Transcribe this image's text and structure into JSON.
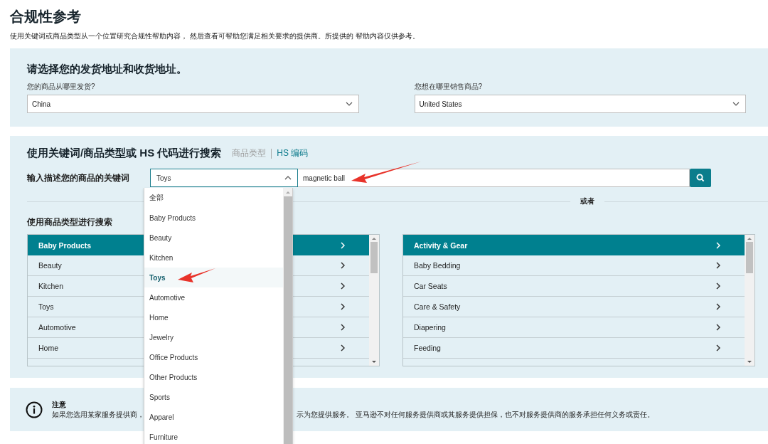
{
  "page": {
    "title": "合规性参考",
    "description": "使用关键词或商品类型从一个位置研究合规性帮助内容， 然后查看可帮助您满足相关要求的提供商。所提供的 帮助内容仅供参考。"
  },
  "address": {
    "title": "请选择您的发货地址和收货地址。",
    "fields": [
      {
        "label": "您的商品从哪里发货?",
        "value": "China"
      },
      {
        "label": "您想在哪里销售商品?",
        "value": "United States"
      }
    ]
  },
  "search": {
    "title": "使用关键词/商品类型或 HS 代码进行搜索",
    "modes": [
      {
        "label": "商品类型",
        "selected": false
      },
      {
        "label": "HS 编码",
        "selected": true
      }
    ],
    "keyword_label": "输入描述您的商品的关键词",
    "category_select": {
      "value": "Toys",
      "expanded": true
    },
    "keyword_input": {
      "value": "magnetic ball"
    },
    "divider_text": "或者",
    "category_title": "使用商品类型进行搜索",
    "dropdown_options": [
      {
        "label": "全部",
        "selected": false
      },
      {
        "label": "Baby Products",
        "selected": false
      },
      {
        "label": "Beauty",
        "selected": false
      },
      {
        "label": "Kitchen",
        "selected": false
      },
      {
        "label": "Toys",
        "selected": true
      },
      {
        "label": "Automotive",
        "selected": false
      },
      {
        "label": "Home",
        "selected": false
      },
      {
        "label": "Jewelry",
        "selected": false
      },
      {
        "label": "Office Products",
        "selected": false
      },
      {
        "label": "Other Products",
        "selected": false
      },
      {
        "label": "Sports",
        "selected": false
      },
      {
        "label": "Apparel",
        "selected": false
      },
      {
        "label": "Furniture",
        "selected": false
      }
    ],
    "category_list": [
      {
        "label": "Baby Products",
        "selected": true
      },
      {
        "label": "Beauty",
        "selected": false
      },
      {
        "label": "Kitchen",
        "selected": false
      },
      {
        "label": "Toys",
        "selected": false
      },
      {
        "label": "Automotive",
        "selected": false
      },
      {
        "label": "Home",
        "selected": false
      }
    ],
    "subcategory_list": [
      {
        "label": "Activity & Gear",
        "selected": true
      },
      {
        "label": "Baby Bedding",
        "selected": false
      },
      {
        "label": "Car Seats",
        "selected": false
      },
      {
        "label": "Care & Safety",
        "selected": false
      },
      {
        "label": "Diapering",
        "selected": false
      },
      {
        "label": "Feeding",
        "selected": false
      }
    ]
  },
  "notice": {
    "title": "注意",
    "text_parts": [
      "如果您选用某家服务提供商，",
      "示为您提供服务。 亚马逊不对任何服务提供商或其服务提供担保，也不对服务提供商的服务承担任何义务或责任。"
    ]
  }
}
